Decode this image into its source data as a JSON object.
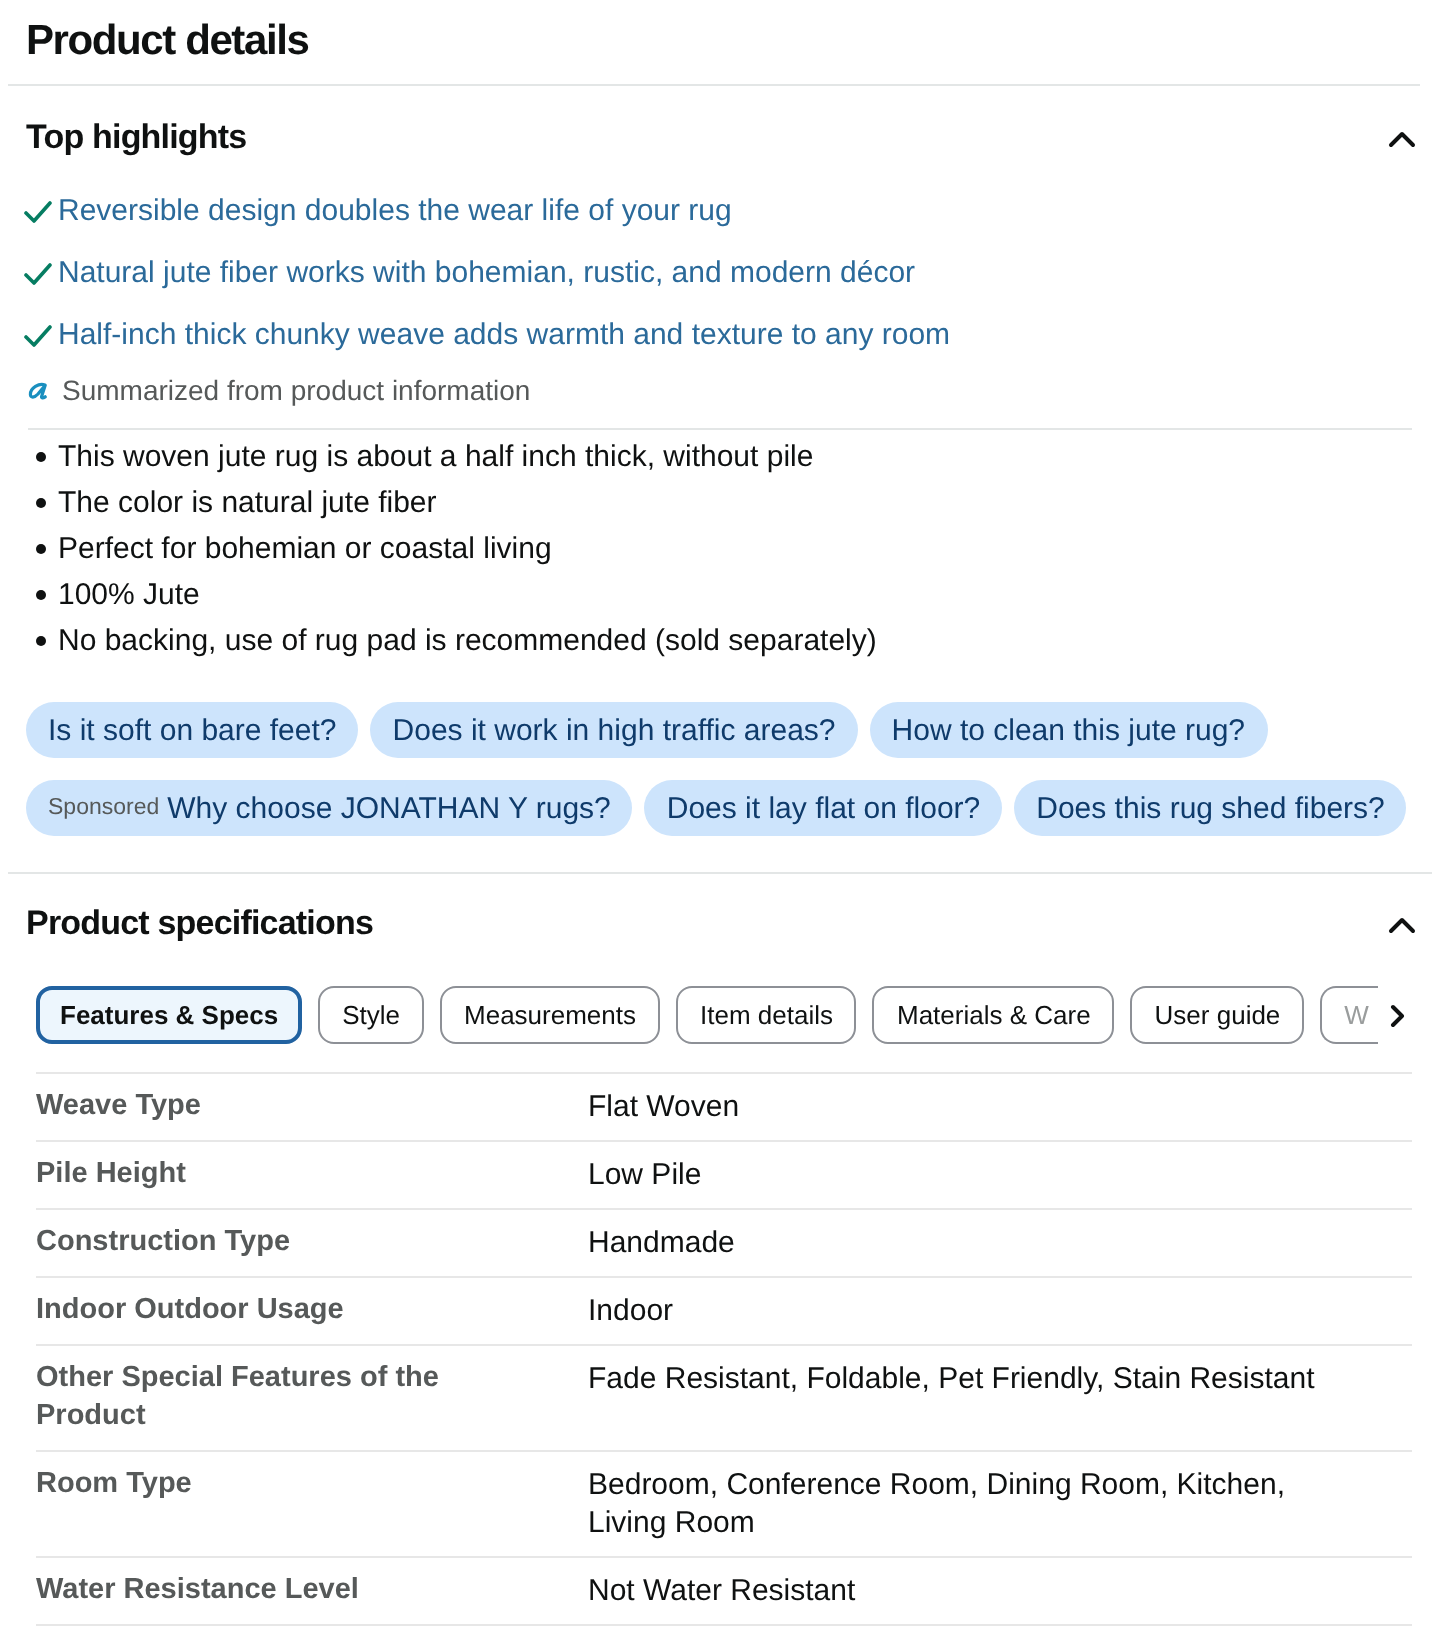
{
  "page": {
    "title": "Product details"
  },
  "top_highlights": {
    "title": "Top highlights",
    "expanded": true,
    "highlights": [
      "Reversible design doubles the wear life of your rug",
      "Natural jute fiber works with bohemian, rustic, and modern décor",
      "Half-inch thick chunky weave adds warmth and texture to any room"
    ],
    "summary_note": "Summarized from product information",
    "bullets": [
      "This woven jute rug is about a half inch thick, without pile",
      "The color is natural jute fiber",
      "Perfect for bohemian or coastal living",
      "100% Jute",
      "No backing, use of rug pad is recommended (sold separately)"
    ],
    "questions": [
      {
        "kind": "question",
        "text": "Is it soft on bare feet?"
      },
      {
        "kind": "question",
        "text": "Does it work in high traffic areas?"
      },
      {
        "kind": "question",
        "text": "How to clean this jute rug?"
      },
      {
        "kind": "sponsored",
        "label": "Sponsored",
        "text": "Why choose JONATHAN Y rugs?"
      },
      {
        "kind": "question",
        "text": "Does it lay flat on floor?"
      },
      {
        "kind": "question",
        "text": "Does this rug shed fibers?"
      }
    ]
  },
  "product_specifications": {
    "title": "Product specifications",
    "expanded": true,
    "tabs": [
      {
        "label": "Features & Specs",
        "selected": true
      },
      {
        "label": "Style",
        "selected": false
      },
      {
        "label": "Measurements",
        "selected": false
      },
      {
        "label": "Item details",
        "selected": false
      },
      {
        "label": "Materials & Care",
        "selected": false
      },
      {
        "label": "User guide",
        "selected": false
      },
      {
        "label": "W",
        "selected": false
      }
    ],
    "rows": [
      {
        "label": "Weave Type",
        "value": "Flat Woven"
      },
      {
        "label": "Pile Height",
        "value": "Low Pile"
      },
      {
        "label": "Construction Type",
        "value": "Handmade"
      },
      {
        "label": "Indoor Outdoor Usage",
        "value": "Indoor"
      },
      {
        "label": "Other Special Features of the Product",
        "value": "Fade Resistant, Foldable, Pet Friendly, Stain Resistant"
      },
      {
        "label": "Room Type",
        "value": "Bedroom, Conference Room, Dining Room, Kitchen, Living Room"
      },
      {
        "label": "Water Resistance Level",
        "value": "Not Water Resistant"
      }
    ]
  }
}
